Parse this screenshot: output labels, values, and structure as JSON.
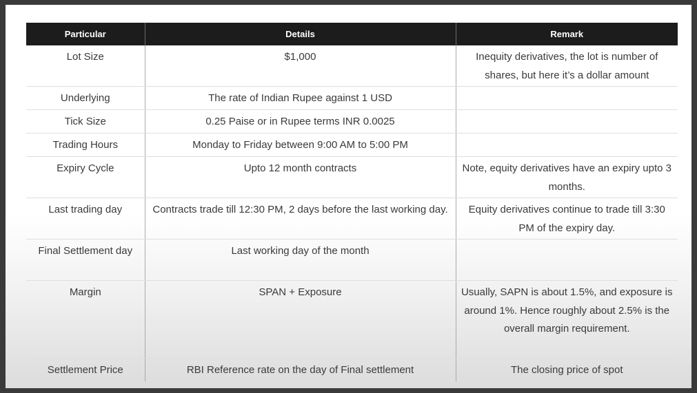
{
  "table": {
    "headers": {
      "particular": "Particular",
      "details": "Details",
      "remark": "Remark"
    },
    "rows": [
      {
        "particular": "Lot Size",
        "details": "$1,000",
        "remark": "Inequity derivatives, the lot is number of shares, but here it’s a dollar amount"
      },
      {
        "particular": "Underlying",
        "details": "The rate of Indian Rupee against 1 USD",
        "remark": ""
      },
      {
        "particular": "Tick Size",
        "details": "0.25 Paise or in Rupee terms INR 0.0025",
        "remark": ""
      },
      {
        "particular": "Trading Hours",
        "details": "Monday to Friday between 9:00 AM to 5:00 PM",
        "remark": ""
      },
      {
        "particular": "Expiry Cycle",
        "details": "Upto 12 month contracts",
        "remark": "Note, equity derivatives have an expiry upto 3 months."
      },
      {
        "particular": "Last trading day",
        "details": "Contracts trade till 12:30 PM, 2 days before the last working day.",
        "remark": "Equity derivatives continue to trade till 3:30 PM of the expiry day."
      },
      {
        "particular": "Final Settlement day",
        "details": "Last working day of the month",
        "remark": ""
      },
      {
        "particular": "Margin",
        "details": "SPAN + Exposure",
        "remark": "Usually, SAPN is about 1.5%, and exposure is around 1%. Hence roughly about 2.5% is the overall margin requirement."
      },
      {
        "particular": "Settlement Price",
        "details": "RBI Reference rate on the day of Final settlement",
        "remark": "The closing price of spot"
      }
    ]
  }
}
